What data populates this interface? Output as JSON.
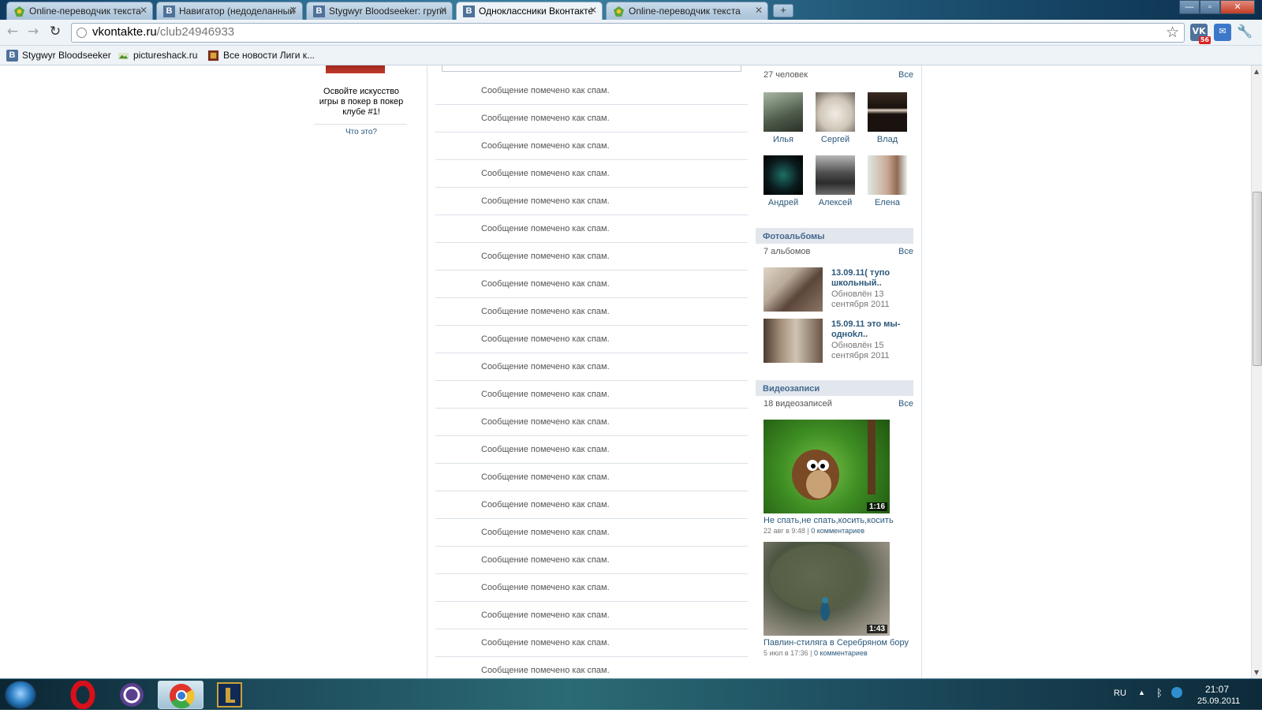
{
  "browser": {
    "tabs": [
      {
        "title": "Online-переводчик текста",
        "active": false
      },
      {
        "title": "Навигатор (недоделанный",
        "active": false
      },
      {
        "title": "Stygwyr Bloodseeker: групп",
        "active": false
      },
      {
        "title": "Одноклассники Вконтакте",
        "active": true
      },
      {
        "title": "Online-переводчик текста",
        "active": false
      }
    ],
    "new_tab_label": "+",
    "url_domain": "vkontakte.ru",
    "url_path": "/club24946933",
    "vk_extension_label": "VK",
    "vk_badge_count": "56",
    "window_buttons": {
      "minimize": "—",
      "maximize": "▫",
      "close": "✕"
    }
  },
  "bookmarks": [
    {
      "label": "Stygwyr Bloodseeker",
      "icon": "vk-icon"
    },
    {
      "label": "pictureshack.ru",
      "icon": "pictureshack-icon"
    },
    {
      "label": "Все новости Лиги к...",
      "icon": "league-news-icon"
    }
  ],
  "ad": {
    "text": "Освойте искусство игры в покер в покер клубе #1!",
    "what_link": "Что это?"
  },
  "wall": {
    "spam_message": "Сообщение помечено как спам.",
    "rows": [
      "Сообщение помечено как спам.",
      "Сообщение помечено как спам.",
      "Сообщение помечено как спам.",
      "Сообщение помечено как спам.",
      "Сообщение помечено как спам.",
      "Сообщение помечено как спам.",
      "Сообщение помечено как спам.",
      "Сообщение помечено как спам.",
      "Сообщение помечено как спам.",
      "Сообщение помечено как спам.",
      "Сообщение помечено как спам.",
      "Сообщение помечено как спам.",
      "Сообщение помечено как спам.",
      "Сообщение помечено как спам.",
      "Сообщение помечено как спам.",
      "Сообщение помечено как спам.",
      "Сообщение помечено как спам.",
      "Сообщение помечено как спам.",
      "Сообщение помечено как спам.",
      "Сообщение помечено как спам.",
      "Сообщение помечено как спам.",
      "Сообщение помечено как спам."
    ]
  },
  "members": {
    "count_label": "27 человек",
    "all_label": "Все",
    "items": [
      {
        "name": "Илья"
      },
      {
        "name": "Сергей"
      },
      {
        "name": "Влад"
      },
      {
        "name": "Андрей"
      },
      {
        "name": "Алексей"
      },
      {
        "name": "Елена"
      }
    ]
  },
  "albums": {
    "heading": "Фотоальбомы",
    "count_label": "7 альбомов",
    "all_label": "Все",
    "items": [
      {
        "title": "13.09.11( тупо школьный..",
        "updated": "Обновлён 13 сентября 2011"
      },
      {
        "title": "15.09.11 это мы-одноkл..",
        "updated": "Обновлён 15 сентября 2011"
      }
    ]
  },
  "videos": {
    "heading": "Видеозаписи",
    "count_label": "18 видеозаписей",
    "all_label": "Все",
    "items": [
      {
        "title": "Не спать,не спать,косить,косить",
        "duration": "1:16",
        "date": "22 авг в 9:48",
        "comments": "0 комментариев"
      },
      {
        "title": "Павлин-стиляга в Серебряном бору",
        "duration": "1:43",
        "date": "5 июл в 17:36",
        "comments": "0 комментариев"
      }
    ]
  },
  "taskbar": {
    "language": "RU",
    "time": "21:07",
    "date": "25.09.2011"
  },
  "colors": {
    "vk_link": "#2b587a",
    "vk_header_bg": "#e1e7ed",
    "vk_header_text": "#45688e",
    "separator": "#dae1e8"
  }
}
